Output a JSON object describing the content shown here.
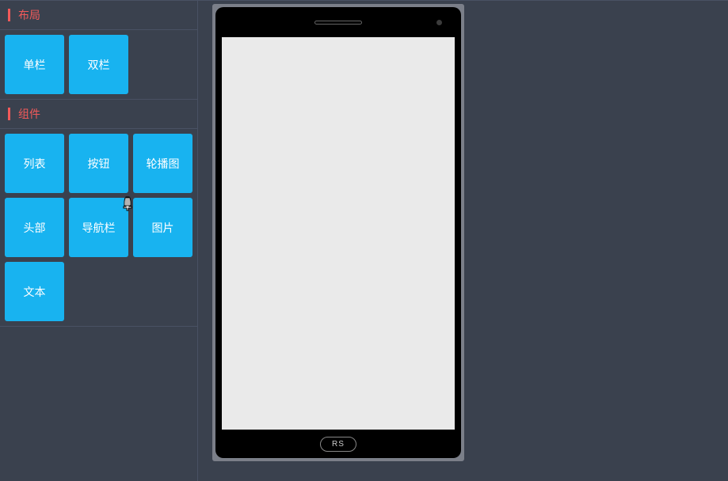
{
  "sidebar": {
    "layout": {
      "title": "布局",
      "items": [
        {
          "label": "单栏"
        },
        {
          "label": "双栏"
        }
      ]
    },
    "components": {
      "title": "组件",
      "items": [
        {
          "label": "列表"
        },
        {
          "label": "按钮"
        },
        {
          "label": "轮播图"
        },
        {
          "label": "头部"
        },
        {
          "label": "导航栏"
        },
        {
          "label": "图片"
        },
        {
          "label": "文本"
        }
      ]
    }
  },
  "phone": {
    "home_label": "RS"
  }
}
